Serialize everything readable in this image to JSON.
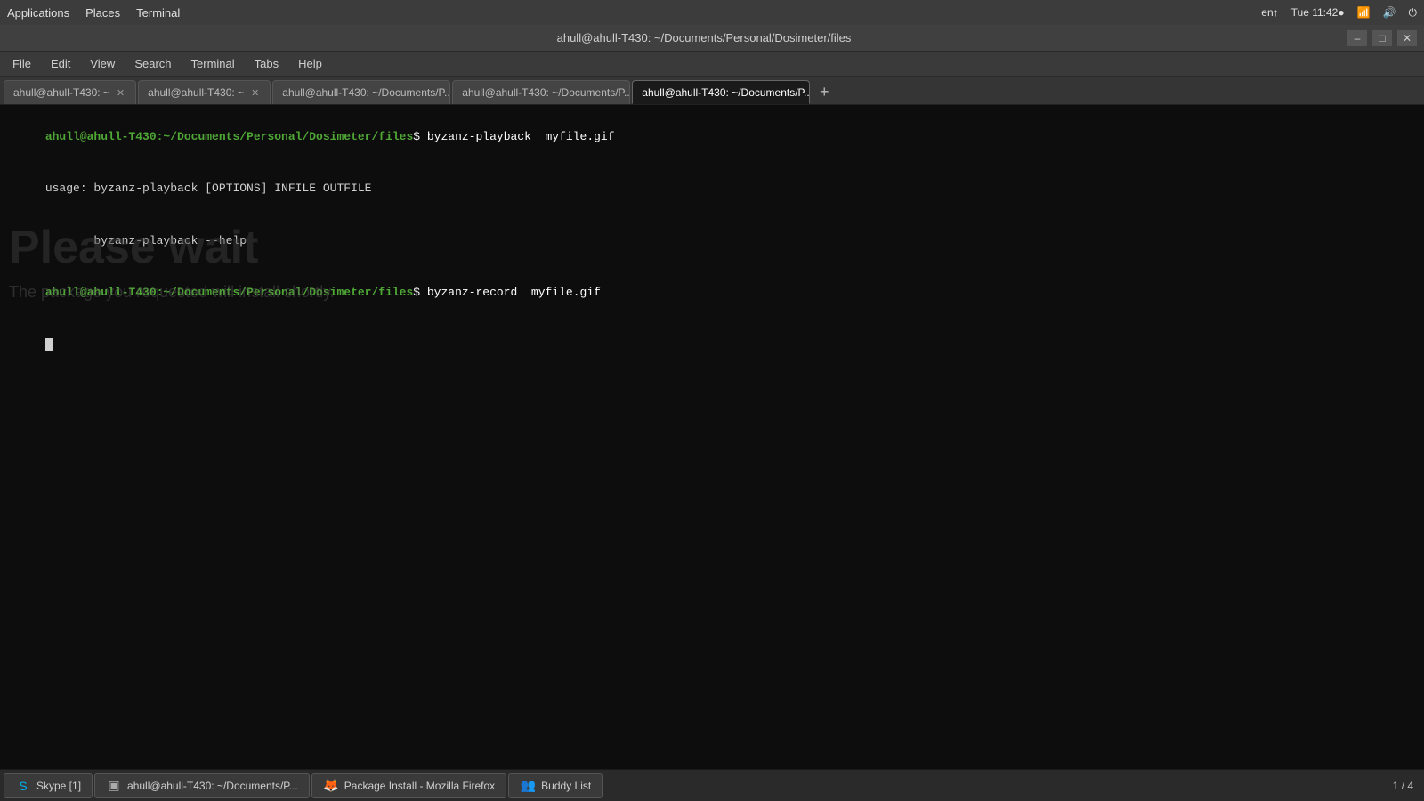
{
  "system_bar": {
    "left_items": [
      "Applications",
      "Places",
      "Terminal"
    ],
    "right_items": [
      "en↑",
      "Tue 11:42●",
      "📶",
      "🔊",
      "⏻"
    ]
  },
  "title_bar": {
    "title": "ahull@ahull-T430: ~/Documents/Personal/Dosimeter/files",
    "minimize_label": "–",
    "maximize_label": "□",
    "close_label": "✕"
  },
  "menu_bar": {
    "items": [
      "File",
      "Edit",
      "View",
      "Search",
      "Terminal",
      "Tabs",
      "Help"
    ]
  },
  "tabs": [
    {
      "label": "ahull@ahull-T430: ~",
      "active": false,
      "id": "tab1"
    },
    {
      "label": "ahull@ahull-T430: ~",
      "active": false,
      "id": "tab2"
    },
    {
      "label": "ahull@ahull-T430: ~/Documents/P...",
      "active": false,
      "id": "tab3"
    },
    {
      "label": "ahull@ahull-T430: ~/Documents/P...",
      "active": false,
      "id": "tab4"
    },
    {
      "label": "ahull@ahull-T430: ~/Documents/P...",
      "active": true,
      "id": "tab5"
    }
  ],
  "terminal": {
    "lines": [
      {
        "type": "prompt_command",
        "prompt": "ahull@ahull-T430:~/Documents/Personal/Dosimeter/files",
        "command": "$ byzanz-playback  myfile.gif"
      },
      {
        "type": "output",
        "text": "usage: byzanz-playback [OPTIONS] INFILE OUTFILE"
      },
      {
        "type": "output",
        "text": "       byzanz-playback --help"
      },
      {
        "type": "prompt_command",
        "prompt": "ahull@ahull-T430:~/Documents/Personal/Dosimeter/files",
        "command": "$ byzanz-record  myfile.gif"
      }
    ],
    "overlay_large": "Please wait",
    "overlay_small": "The package you requested will install shortly."
  },
  "taskbar": {
    "items": [
      {
        "id": "skype",
        "icon": "S",
        "label": "Skype [1]",
        "icon_type": "skype"
      },
      {
        "id": "terminal",
        "icon": "▣",
        "label": "ahull@ahull-T430: ~/Documents/P...",
        "icon_type": "terminal"
      },
      {
        "id": "firefox",
        "icon": "🦊",
        "label": "Package Install - Mozilla Firefox",
        "icon_type": "firefox"
      },
      {
        "id": "buddy",
        "icon": "👥",
        "label": "Buddy List",
        "icon_type": "buddy"
      }
    ],
    "page_indicator": "1 / 4"
  }
}
